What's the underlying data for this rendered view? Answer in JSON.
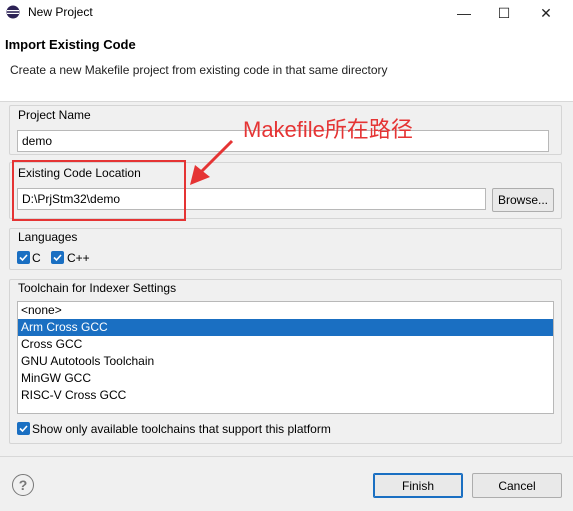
{
  "window": {
    "title": "New Project",
    "controls": {
      "minimize": "—",
      "maximize": "☐",
      "close": "✕"
    }
  },
  "header": {
    "title": "Import Existing Code",
    "description": "Create a new Makefile project from existing code in that same directory"
  },
  "project_name": {
    "label": "Project Name",
    "value": "demo"
  },
  "code_location": {
    "label": "Existing Code Location",
    "value": "D:\\PrjStm32\\demo",
    "browse_label": "Browse..."
  },
  "languages": {
    "label": "Languages",
    "items": [
      {
        "label": "C",
        "checked": true
      },
      {
        "label": "C++",
        "checked": true
      }
    ]
  },
  "toolchain": {
    "label": "Toolchain for Indexer Settings",
    "items": [
      "<none>",
      "Arm Cross GCC",
      "Cross GCC",
      "GNU Autotools Toolchain",
      "MinGW GCC",
      "RISC-V Cross GCC"
    ],
    "selected_index": 1,
    "show_only_label": "Show only available toolchains that support this platform",
    "show_only_checked": true
  },
  "annotation": {
    "text": "Makefile所在路径",
    "color": "#e53434"
  },
  "footer": {
    "help_glyph": "?",
    "finish_label": "Finish",
    "cancel_label": "Cancel"
  },
  "colors": {
    "accent": "#1a6fc2",
    "annotation_red": "#e53434"
  }
}
